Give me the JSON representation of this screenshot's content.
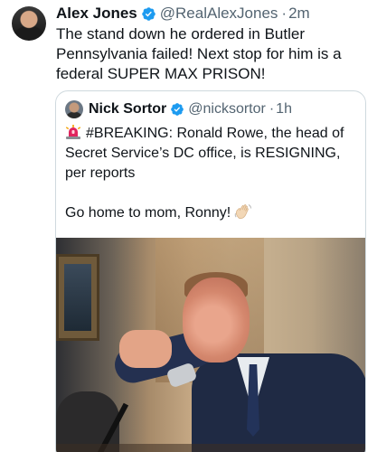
{
  "tweet": {
    "author": {
      "display_name": "Alex Jones",
      "handle": "@RealAlexJones",
      "separator": "·",
      "time": "2m",
      "verified": true
    },
    "text": "The stand down he ordered in Butler Pennsylvania failed! Next stop for him is a federal SUPER MAX PRISON!"
  },
  "quote": {
    "author": {
      "display_name": "Nick Sortor",
      "handle": "@nicksortor",
      "separator": "·",
      "time": "1h",
      "verified": true
    },
    "text_main": "#BREAKING: Ronald Rowe, the head of Secret Service’s DC office, is RESIGNING, per reports",
    "text_tail": "Go home to mom, Ronny!",
    "leading_icon": "rotating-light-icon",
    "trailing_icon": "waving-hand-icon"
  },
  "colors": {
    "text_primary": "#0f1419",
    "text_secondary": "#536471",
    "verified_blue": "#1d9bf0",
    "border": "#cfd9de"
  }
}
